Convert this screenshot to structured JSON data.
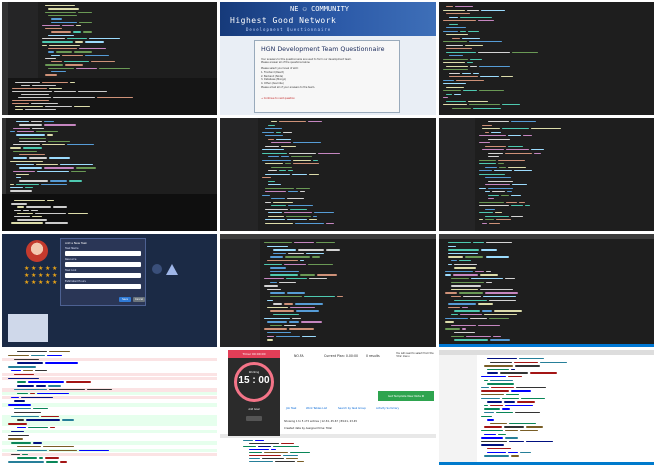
{
  "colors": {
    "editor_bg": "#1e1e1e",
    "accent_blue": "#007acc",
    "banner_blue": "#2c5aa8",
    "timer_red": "#e23e57",
    "success_green": "#2ea44f"
  },
  "questionnaire": {
    "banner_top": "NE ⚇ COMMUNITY",
    "banner_title": "Highest Good Network",
    "banner_subtitle": "Development Questionnaire",
    "title": "HGN Development Team Questionnaire",
    "intro_1": "Your answers to this questionnaire are used to form our development team.",
    "intro_2": "Please answer all of the questions below.",
    "list_heading": "Please select your level of skill:",
    "items": [
      "1. Frontend (React)",
      "2. Backend (Node)",
      "3. Database (Mongo)",
      "4. Other (describe)"
    ],
    "footer": "Please email all of your answers to the team.",
    "link": "→ Continue to next question"
  },
  "dialog": {
    "title": "Add a New Task",
    "fields": [
      "Task Name",
      "Resource",
      "Task Link",
      "Estimated Hours"
    ],
    "save_label": "Save",
    "cancel_label": "Cancel"
  },
  "timer": {
    "header": "Timer 00:00:00",
    "time": "15 : 00",
    "status": "Working",
    "sub_label": "Add Goal",
    "stats": [
      "NO.FA",
      "Current Plan: 0.00:00",
      "0 results"
    ],
    "notice": "You will need to select from the 'Cha' menu",
    "action_button": "Get Template New Note ✚",
    "links": [
      "Job Task",
      "Work Tables List",
      "Search by task Group",
      "Activity Summary"
    ],
    "line_1": "Showing 1 to 5 of 5 entries | 12.34, 45.67 | 89.01, 23.45",
    "line_2": "Created date by Assigned time: Total"
  }
}
